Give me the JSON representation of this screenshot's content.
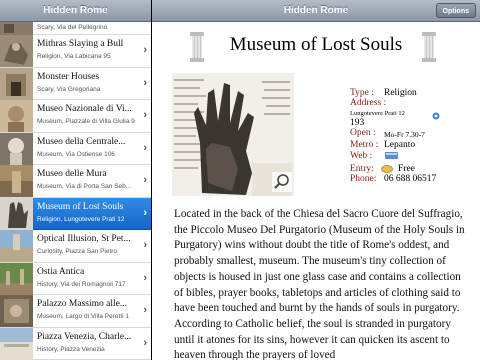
{
  "left_pane": {
    "title": "Hidden Rome",
    "items": [
      {
        "title": "",
        "subtitle": "Scary, Via del Pellegrino"
      },
      {
        "title": "Mithras Slaying a Bull",
        "subtitle": "Religion, Via Labicana 95"
      },
      {
        "title": "Monster Houses",
        "subtitle": "Scary, Via Gregoriana"
      },
      {
        "title": "Museo Nazionale di Vi...",
        "subtitle": "Museum, Piazzale di Villa Giulia 9"
      },
      {
        "title": "Museo della Centrale...",
        "subtitle": "Museum, Via Ostiense 106"
      },
      {
        "title": "Museo delle Mura",
        "subtitle": "Museum, Via di Porta San Seb..."
      },
      {
        "title": "Museum of Lost Souls",
        "subtitle": "Religion, Lungotevere Prati 12"
      },
      {
        "title": "Optical Illusion, St Pet...",
        "subtitle": "Curiosity, Piazza San Pietro"
      },
      {
        "title": "Ostia Antica",
        "subtitle": "History, Via dei Romagnoli 717"
      },
      {
        "title": "Palazzo Massimo alle...",
        "subtitle": "Museum, Largo di Villa Peretti 1"
      },
      {
        "title": "Piazza Venezia, Charle...",
        "subtitle": "History, Piazza Venezia"
      }
    ],
    "selected_index": 6
  },
  "detail": {
    "nav_title": "Hidden Rome",
    "options_label": "Options",
    "title": "Museum of Lost Souls",
    "type_label": "Type :",
    "type_value": "Religion",
    "address_label": "Address :",
    "address_line1": "Lungotevere Prati 12",
    "address_line2": "193",
    "open_label": "Open :",
    "open_value": "Mo-Fr 7.30-7",
    "metro_label": "Metro :",
    "metro_value": "Lepanto",
    "web_label": "Web :",
    "entry_label": "Entry:",
    "entry_value": "Free",
    "phone_label": "Phone:",
    "phone_value": "06 688 06517",
    "description": "Located in the back of the Chiesa del Sacro Cuore del Suffragio, the Piccolo Museo Del Purgatorio (Museum of the Holy Souls in Purgatory) wins without doubt the title of Rome's oddest, and probably smallest, museum. The museum's tiny collection of objects is housed in just one glass case and contains a collection of bibles, prayer books, tabletops and articles of clothing said to have been touched and burnt by the hands of souls in purgatory. According to Catholic belief, the soul is stranded in purgatory until it atones for its sins, however it can quicken its ascent to heaven through the prayers of loved"
  },
  "colors": {
    "label_red": "#8b1a1a",
    "selection_blue": "#1f76d8",
    "navbar": "#9aa4b2"
  }
}
